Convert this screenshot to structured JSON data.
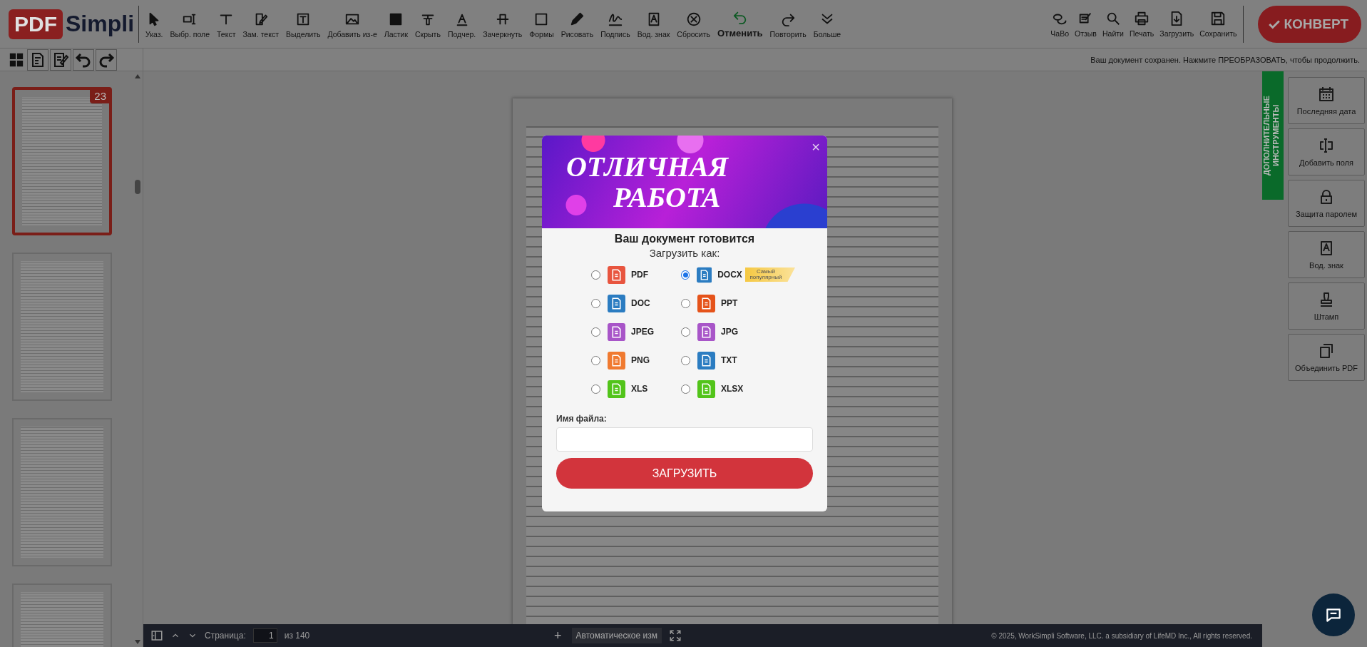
{
  "logo": {
    "badge": "PDF",
    "name": "Simpli"
  },
  "toolbar": [
    {
      "label": "Указ.",
      "highlighted": false
    },
    {
      "label": "Выбр. поле",
      "highlighted": false
    },
    {
      "label": "Текст",
      "highlighted": false
    },
    {
      "label": "Зам. текст",
      "highlighted": false
    },
    {
      "label": "Выделить",
      "highlighted": false
    },
    {
      "label": "Добавить из-е",
      "highlighted": false
    },
    {
      "label": "Ластик",
      "highlighted": false
    },
    {
      "label": "Скрыть",
      "highlighted": false
    },
    {
      "label": "Подчер.",
      "highlighted": false
    },
    {
      "label": "Зачеркнуть",
      "highlighted": false
    },
    {
      "label": "Формы",
      "highlighted": false
    },
    {
      "label": "Рисовать",
      "highlighted": false
    },
    {
      "label": "Подпись",
      "highlighted": false
    },
    {
      "label": "Вод. знак",
      "highlighted": false
    },
    {
      "label": "Сбросить",
      "highlighted": false
    },
    {
      "label": "Отменить",
      "highlighted": true
    },
    {
      "label": "Повторить",
      "highlighted": false
    },
    {
      "label": "Больше",
      "highlighted": false
    }
  ],
  "right_toolbar": [
    {
      "label": "ЧаВо"
    },
    {
      "label": "Отзыв"
    },
    {
      "label": "Найти"
    },
    {
      "label": "Печать"
    },
    {
      "label": "Загрузить"
    },
    {
      "label": "Сохранить"
    }
  ],
  "convert_button": {
    "label": "КОНВЕРТ"
  },
  "status_message": "Ваш документ сохранен. Нажмите ПРЕОБРАЗОВАТЬ, чтобы продолжить.",
  "thumbnails": [
    {
      "selected": true,
      "badge": "23"
    },
    {
      "selected": false
    },
    {
      "selected": false
    },
    {
      "selected": false
    }
  ],
  "bottom_bar": {
    "page_label": "Страница:",
    "page_value": "1",
    "page_total": "из 140",
    "zoom_in": "+",
    "zoom_mode": "Автоматическое изм",
    "copyright": "© 2025, WorkSimpli Software, LLC. a subsidiary of LifeMD Inc., All rights reserved."
  },
  "side_panel": {
    "tab": "ДОПОЛНИТЕЛЬНЫЕ ИНСТРУМЕНТЫ",
    "tools": [
      {
        "label": "Последняя дата"
      },
      {
        "label": "Добавить поля"
      },
      {
        "label": "Защита паролем"
      },
      {
        "label": "Вод. знак"
      },
      {
        "label": "Штамп"
      },
      {
        "label": "Объединить PDF"
      }
    ]
  },
  "modal": {
    "banner_lines": [
      "ОТЛИЧНАЯ",
      "РАБОТА"
    ],
    "close": "×",
    "title": "Ваш документ готовится",
    "subtitle": "Загрузить как:",
    "formats": [
      {
        "label": "PDF",
        "selected": false,
        "color": "#e8553f"
      },
      {
        "label": "DOCX",
        "selected": true,
        "color": "#2b7cc1",
        "badge": "Самый популярный"
      },
      {
        "label": "DOC",
        "selected": false,
        "color": "#2b7cc1"
      },
      {
        "label": "PPT",
        "selected": false,
        "color": "#e5531a"
      },
      {
        "label": "JPEG",
        "selected": false,
        "color": "#a855c8"
      },
      {
        "label": "JPG",
        "selected": false,
        "color": "#a855c8"
      },
      {
        "label": "PNG",
        "selected": false,
        "color": "#f07a30"
      },
      {
        "label": "TXT",
        "selected": false,
        "color": "#2b7cc1"
      },
      {
        "label": "XLS",
        "selected": false,
        "color": "#52c41a"
      },
      {
        "label": "XLSX",
        "selected": false,
        "color": "#52c41a"
      }
    ],
    "filename_label": "Имя файла:",
    "download_button": "ЗАГРУЗИТЬ"
  }
}
